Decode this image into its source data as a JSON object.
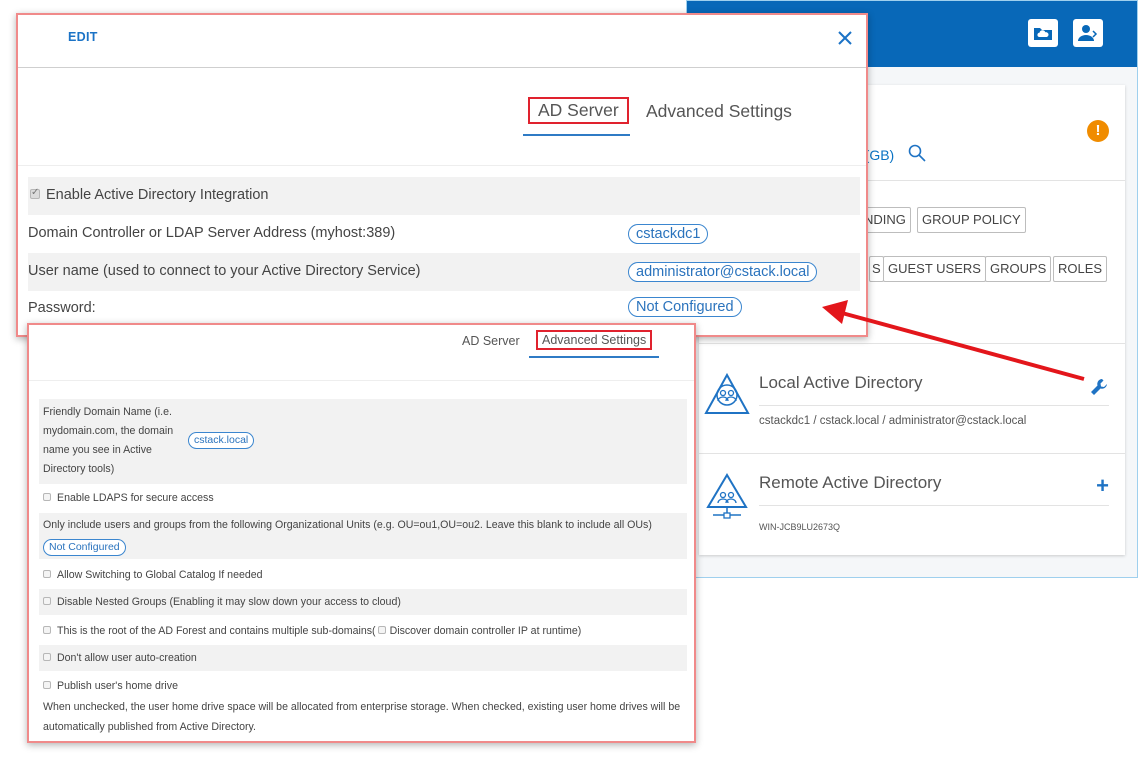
{
  "background": {
    "header_icons": [
      "cloud-folder-icon",
      "user-switch-icon"
    ],
    "storage_label": ")(GB)",
    "chips_row1": [
      "NDING",
      "GROUP POLICY"
    ],
    "chips_row2": [
      "S",
      "GUEST USERS",
      "GROUPS",
      "ROLES"
    ],
    "directories": [
      {
        "title": "Local Active Directory",
        "subtitle": "cstackdc1 / cstack.local / administrator@cstack.local",
        "action_icon": "wrench-icon"
      },
      {
        "title": "Remote Active Directory",
        "subtitle": "WIN-JCB9LU2673Q",
        "action_icon": "plus-icon"
      }
    ],
    "colors": {
      "header": "#0868b8",
      "warning": "#f08c00",
      "accent": "#1f73c4"
    }
  },
  "dialog": {
    "title": "EDIT",
    "tabs": [
      {
        "label": "AD Server",
        "active": true
      },
      {
        "label": "Advanced Settings",
        "active": false
      }
    ],
    "enable_ad": {
      "label": "Enable Active Directory Integration",
      "checked": true
    },
    "fields": [
      {
        "label": "Domain Controller or LDAP Server Address (myhost:389)",
        "value": "cstackdc1"
      },
      {
        "label": "User name (used to connect to your Active Directory Service)",
        "value": "administrator@cstack.local"
      },
      {
        "label": "Password:",
        "value": "Not Configured"
      }
    ]
  },
  "advanced": {
    "tabs": [
      {
        "label": "AD Server",
        "active": false
      },
      {
        "label": "Advanced Settings",
        "active": true
      }
    ],
    "friendly_domain": {
      "label_lines": [
        "Friendly Domain Name (i.e.",
        "mydomain.com, the domain",
        "name you see in Active",
        "Directory tools)"
      ],
      "value": "cstack.local"
    },
    "ldaps": "Enable LDAPS for secure access",
    "ou_filter": {
      "label": "Only include users and groups from the following Organizational Units (e.g. OU=ou1,OU=ou2. Leave this blank to include all OUs)",
      "value": "Not Configured"
    },
    "global_catalog": "Allow Switching to Global Catalog If needed",
    "nested_groups": "Disable Nested Groups (Enabling it may slow down your access to cloud)",
    "forest_root": "This is the root of the AD Forest and contains multiple sub-domains(",
    "discover_dc": "Discover domain controller IP at runtime)",
    "auto_creation": "Don't allow user auto-creation",
    "home_drive": "Publish user's home drive",
    "home_drive_note": "When unchecked, the user home drive space will be allocated from enterprise storage. When checked, existing user home drives will be automatically published from Active Directory."
  }
}
